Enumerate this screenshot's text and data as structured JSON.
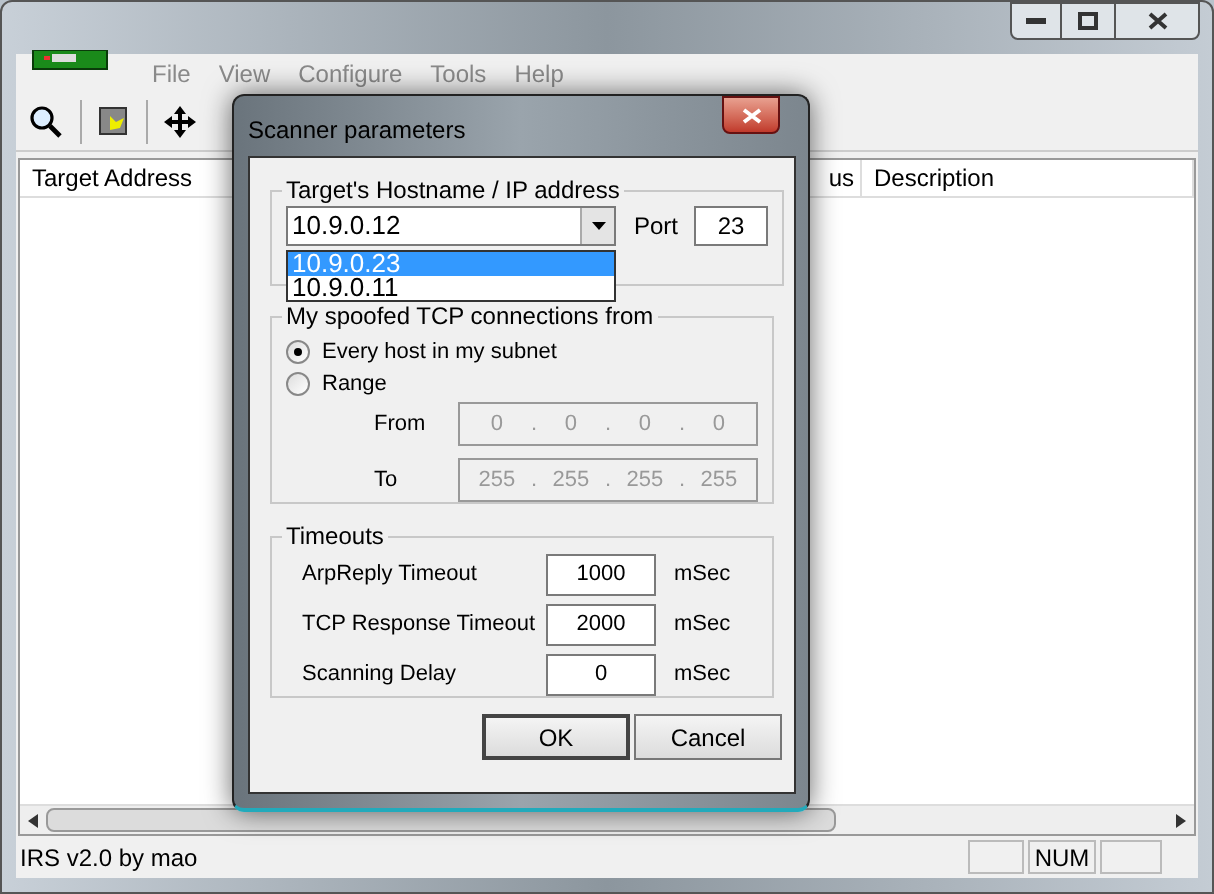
{
  "window": {
    "menu": [
      {
        "label": "File",
        "disabled": true
      },
      {
        "label": "View",
        "disabled": true
      },
      {
        "label": "Configure",
        "disabled": true
      },
      {
        "label": "Tools",
        "disabled": true
      },
      {
        "label": "Help",
        "disabled": true
      }
    ],
    "columns": [
      "Target Address",
      "us",
      "Description"
    ],
    "status_bar": {
      "text": "IRS v2.0 by mao",
      "panels": [
        {
          "kind": "blank"
        },
        {
          "kind": "text",
          "label": "NUM"
        },
        {
          "kind": "blank"
        }
      ]
    }
  },
  "dialog": {
    "title": "Scanner parameters",
    "host_group": {
      "label": "Target's Hostname / IP address",
      "combo": {
        "value": "10.9.0.12",
        "expanded": true,
        "options": [
          {
            "label": "10.9.0.23",
            "selected": true
          },
          {
            "label": "10.9.0.11",
            "selected": false
          }
        ]
      },
      "port": {
        "label": "Port",
        "value": "23"
      }
    },
    "spoof_group": {
      "label": "My spoofed TCP connections from",
      "options": [
        {
          "label": "Every host in my subnet",
          "selected": true
        },
        {
          "label": "Range",
          "selected": false
        }
      ],
      "ranges": [
        {
          "label": "From",
          "octets": [
            "0",
            "0",
            "0",
            "0"
          ],
          "separators": [
            ".",
            ".",
            "."
          ],
          "disabled": true
        },
        {
          "label": "To",
          "octets": [
            "255",
            "255",
            "255",
            "255"
          ],
          "separators": [
            ".",
            ".",
            "."
          ],
          "disabled": true
        }
      ]
    },
    "timeouts": {
      "label": "Timeouts",
      "rows": [
        {
          "label": "ArpReply Timeout",
          "value": "1000",
          "unit": "mSec"
        },
        {
          "label": "TCP Response Timeout",
          "value": "2000",
          "unit": "mSec"
        },
        {
          "label": "Scanning Delay",
          "value": "0",
          "unit": "mSec"
        }
      ]
    },
    "buttons": [
      {
        "label": "OK",
        "default": true
      },
      {
        "label": "Cancel",
        "default": false
      }
    ]
  }
}
